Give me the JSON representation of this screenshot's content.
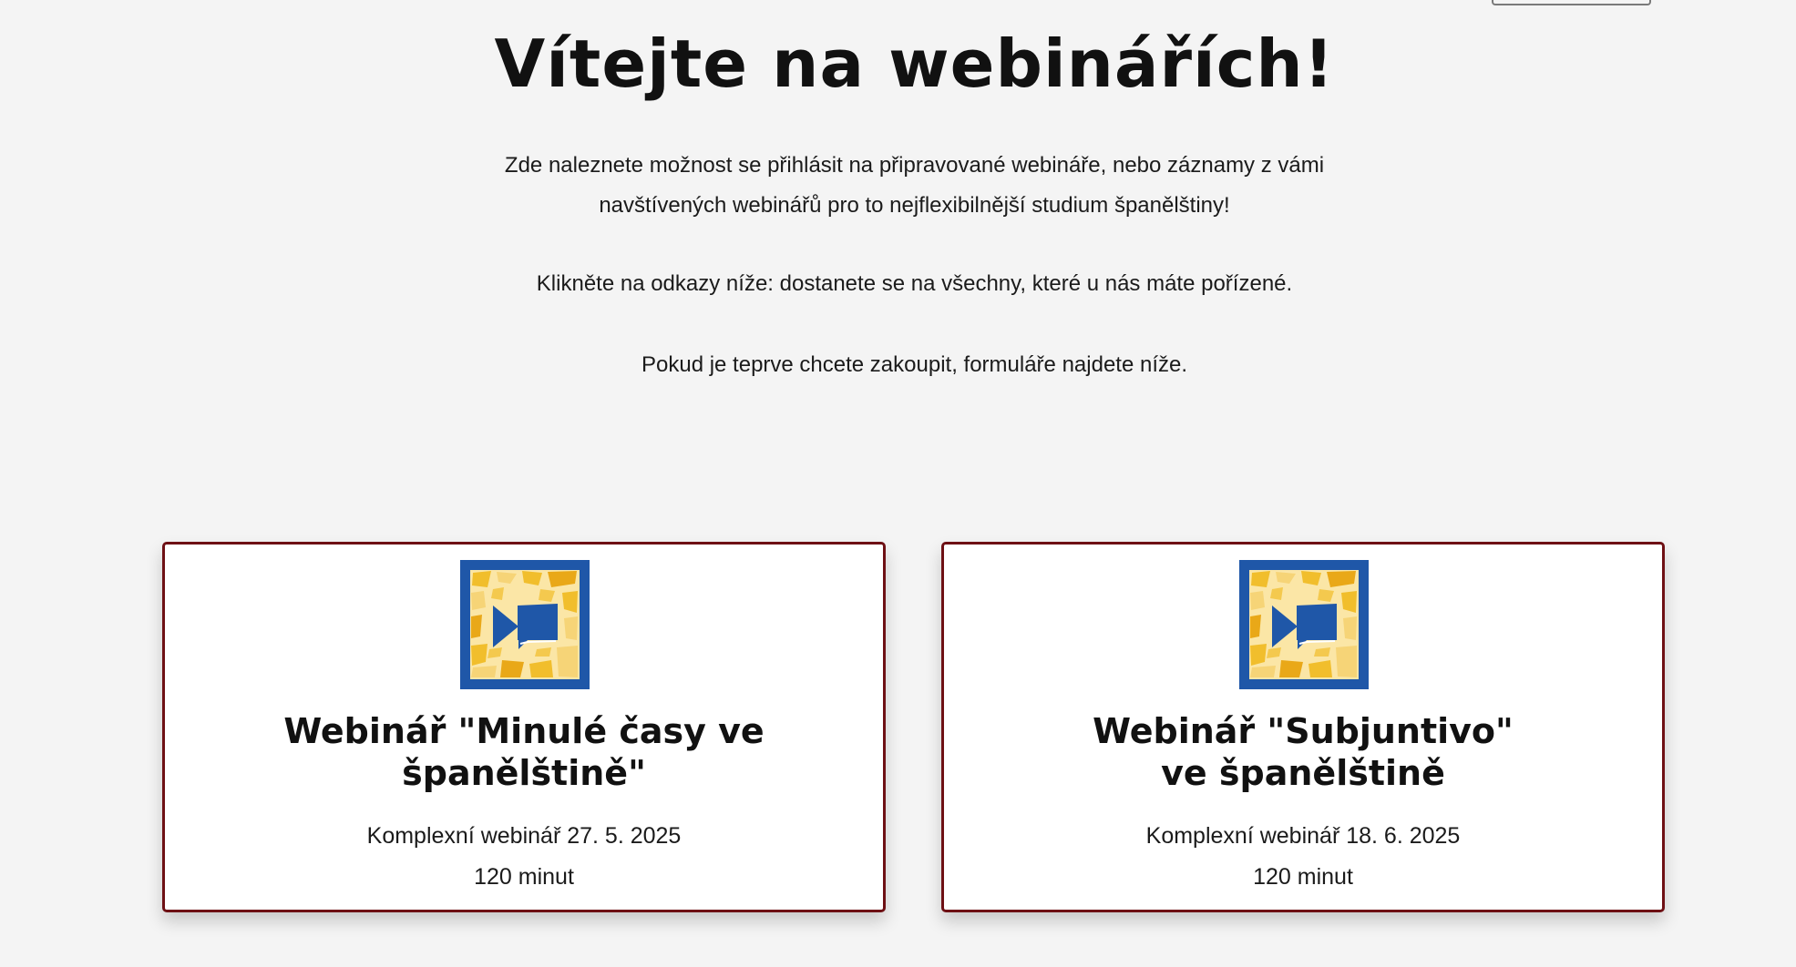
{
  "header": {
    "title": "Vítejte na webinářích!"
  },
  "intro": {
    "line1": "Zde naleznete možnost se přihlásit na připravované webináře, nebo záznamy z vámi",
    "line2": "navštívených webinářů pro to nejflexibilnější studium španělštiny!",
    "line3": "Klikněte na odkazy níže: dostanete se na všechny, které u nás máte pořízené.",
    "line4": "Pokud je teprve chcete zakoupit, formuláře najdete níže."
  },
  "cards": [
    {
      "icon": "webinar-mosaic-play-icon",
      "title_line1": "Webinář \"Minulé časy ve",
      "title_line2": "španělštině\"",
      "date": "Komplexní webinář 27. 5. 2025",
      "duration": "120 minut"
    },
    {
      "icon": "webinar-mosaic-play-icon",
      "title_line1": "Webinář \"Subjuntivo\"",
      "title_line2": "ve španělštině",
      "date": "Komplexní webinář 18. 6. 2025",
      "duration": "120 minut"
    }
  ],
  "colors": {
    "background": "#f4f4f4",
    "card_border": "#6e1014",
    "icon_blue": "#1f57a8",
    "icon_yellow": "#f1be2c"
  }
}
